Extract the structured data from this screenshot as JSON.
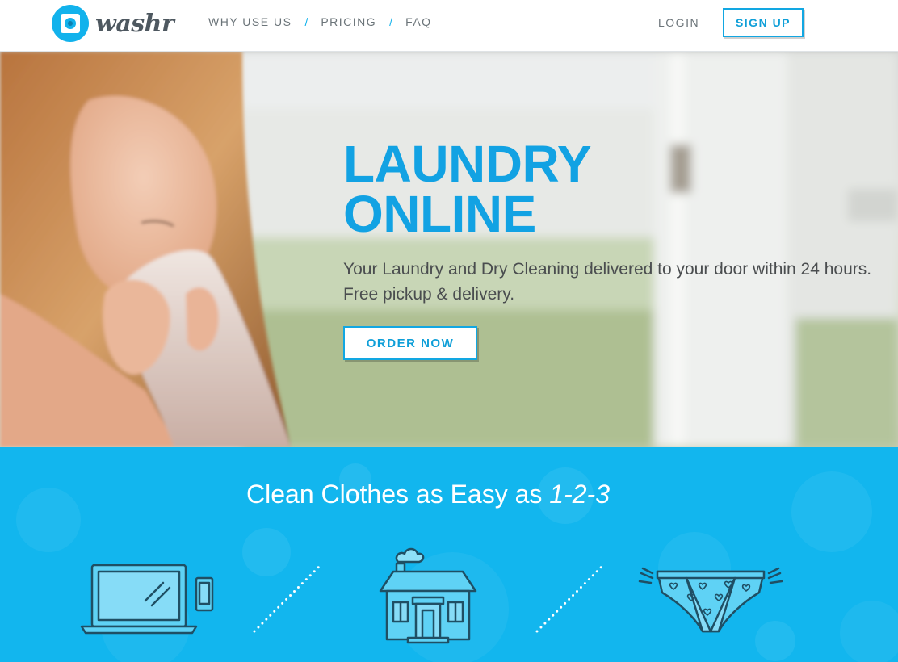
{
  "header": {
    "logo_text": "washr",
    "nav": [
      {
        "label": "WHY USE US"
      },
      {
        "label": "PRICING"
      },
      {
        "label": "FAQ"
      }
    ],
    "nav_separator": "/",
    "login_label": "LOGIN",
    "signup_label": "SIGN UP"
  },
  "hero": {
    "title_line1": "LAUNDRY",
    "title_line2": "ONLINE",
    "subtitle_line1": "Your Laundry and Dry Cleaning delivered to your door within 24 hours.",
    "subtitle_line2": "Free pickup & delivery.",
    "cta_label": "ORDER NOW"
  },
  "steps": {
    "title_prefix": "Clean Clothes as Easy as ",
    "title_emphasis": "1-2-3",
    "icons": [
      "laptop-and-phone-icon",
      "house-icon",
      "underwear-icon"
    ]
  },
  "colors": {
    "brand": "#12b2ec",
    "title_blue": "#12a2e3",
    "section_blue": "#12b6ee",
    "nav_text": "#6b7479",
    "icon_stroke": "#1f4f64"
  }
}
